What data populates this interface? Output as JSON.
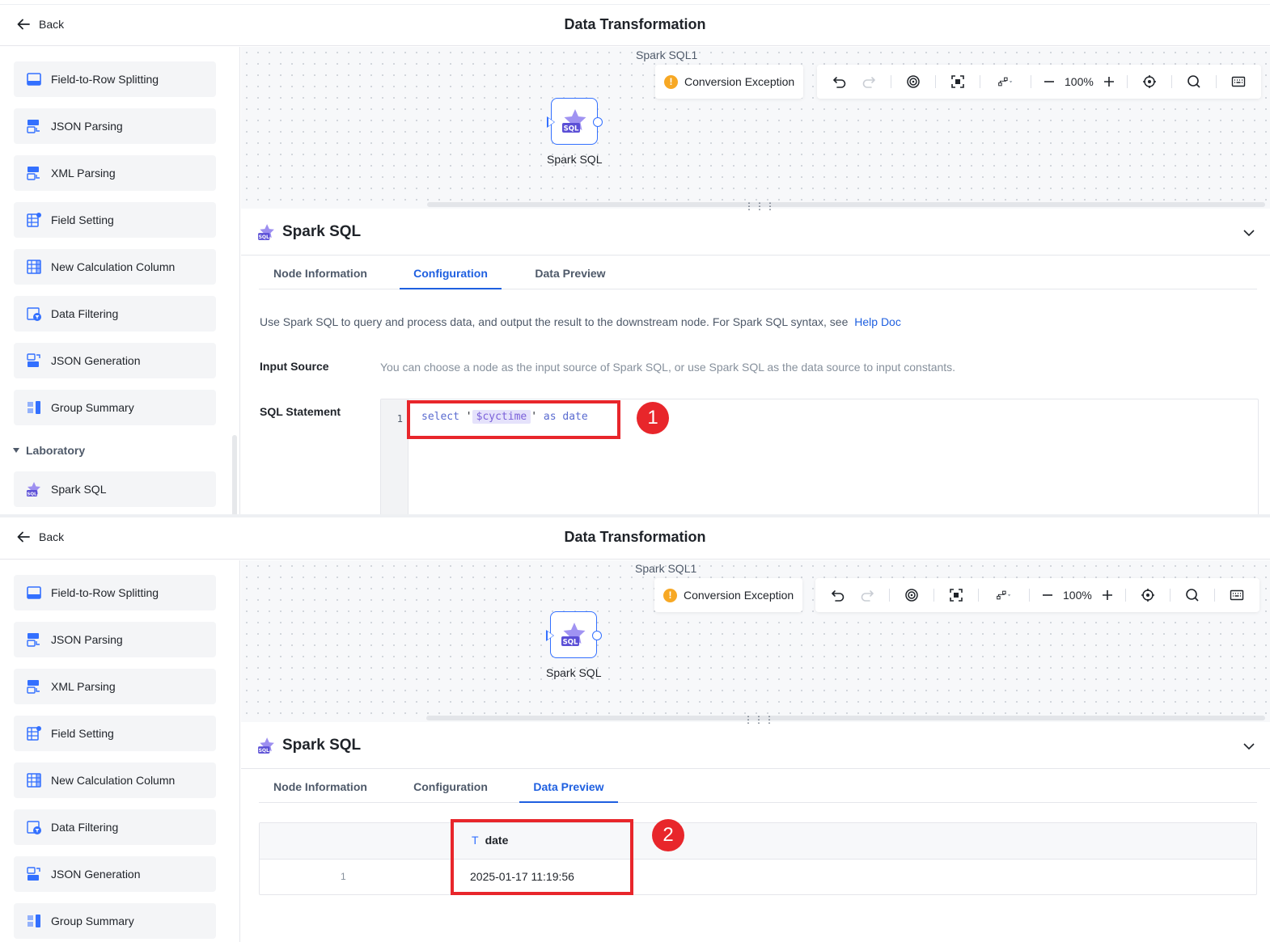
{
  "header": {
    "back_label": "Back",
    "title": "Data Transformation"
  },
  "sidebar": {
    "items": [
      {
        "label": "Field-to-Row Splitting",
        "icon": "split-rows-icon"
      },
      {
        "label": "JSON Parsing",
        "icon": "json-parse-icon"
      },
      {
        "label": "XML Parsing",
        "icon": "xml-parse-icon"
      },
      {
        "label": "Field Setting",
        "icon": "field-setting-icon"
      },
      {
        "label": "New Calculation Column",
        "icon": "calc-column-icon"
      },
      {
        "label": "Data Filtering",
        "icon": "filter-icon"
      },
      {
        "label": "JSON Generation",
        "icon": "json-generate-icon"
      },
      {
        "label": "Group Summary",
        "icon": "group-summary-icon"
      }
    ],
    "group_label": "Laboratory",
    "group_items": [
      {
        "label": "Spark SQL",
        "icon": "spark-sql-icon"
      }
    ]
  },
  "canvas": {
    "caption": "Spark SQL1",
    "exception_label": "Conversion Exception",
    "zoom": "100%",
    "node_label": "Spark SQL",
    "node_badge": "SQL"
  },
  "detail": {
    "title": "Spark SQL",
    "tabs": [
      "Node Information",
      "Configuration",
      "Data Preview"
    ],
    "description": "Use Spark SQL to query and process data, and output the result to the downstream node. For Spark SQL syntax, see",
    "help_link": "Help Doc",
    "input_source_label": "Input Source",
    "input_source_hint": "You can choose a node as the input source of Spark SQL, or use Spark SQL as the data source to input constants.",
    "sql_label": "SQL Statement",
    "line_number": "1",
    "code": {
      "keyword": "select",
      "quote_open": "'",
      "variable": "$cyctime",
      "quote_close": "'",
      "rest": "as date"
    }
  },
  "preview": {
    "column": "date",
    "column_type_icon": "T",
    "rows": [
      {
        "index": "1",
        "date": "2025-01-17 11:19:56"
      }
    ]
  },
  "annotations": {
    "step1": "1",
    "step2": "2"
  },
  "colors": {
    "accent": "#1e5fe0",
    "highlight": "#e8262b",
    "warning": "#f7a824",
    "node_border": "#3370ff"
  }
}
